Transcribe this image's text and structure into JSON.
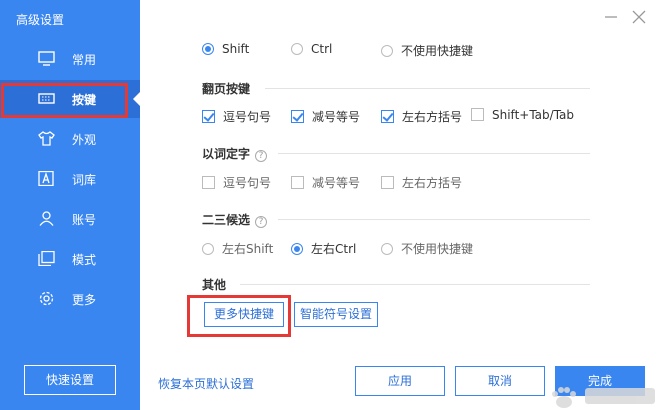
{
  "window": {
    "title": "高级设置"
  },
  "sidebar": {
    "items": [
      {
        "label": "常用",
        "icon": "monitor-icon"
      },
      {
        "label": "按键",
        "icon": "keyboard-icon",
        "active": true
      },
      {
        "label": "外观",
        "icon": "shirt-icon"
      },
      {
        "label": "词库",
        "icon": "letter-a-icon"
      },
      {
        "label": "账号",
        "icon": "user-icon"
      },
      {
        "label": "模式",
        "icon": "window-mode-icon"
      },
      {
        "label": "更多",
        "icon": "gear-icon"
      }
    ],
    "quick_settings_label": "快速设置"
  },
  "switch_key": {
    "options": [
      {
        "label": "Shift",
        "checked": true
      },
      {
        "label": "Ctrl",
        "checked": false
      },
      {
        "label": "不使用快捷键",
        "checked": false
      }
    ]
  },
  "page_turn": {
    "title": "翻页按键",
    "options": [
      {
        "label": "逗号句号",
        "checked": true
      },
      {
        "label": "减号等号",
        "checked": true
      },
      {
        "label": "左右方括号",
        "checked": true
      },
      {
        "label": "Shift+Tab/Tab",
        "checked": false
      }
    ]
  },
  "word_select": {
    "title": "以词定字",
    "help": "?",
    "options": [
      {
        "label": "逗号句号",
        "checked": false
      },
      {
        "label": "减号等号",
        "checked": false
      },
      {
        "label": "左右方括号",
        "checked": false
      }
    ]
  },
  "candidate_23": {
    "title": "二三候选",
    "help": "?",
    "options": [
      {
        "label": "左右Shift",
        "checked": false
      },
      {
        "label": "左右Ctrl",
        "checked": true
      },
      {
        "label": "不使用快捷键",
        "checked": false
      }
    ]
  },
  "other": {
    "title": "其他",
    "more_shortcuts_label": "更多快捷键",
    "smart_symbol_label": "智能符号设置"
  },
  "footer": {
    "restore_label": "恢复本页默认设置",
    "apply_label": "应用",
    "cancel_label": "取消",
    "finish_label": "完成"
  },
  "colors": {
    "accent": "#3a86f0",
    "sidebar_active": "#2c6fd6",
    "highlight": "#e53935"
  }
}
